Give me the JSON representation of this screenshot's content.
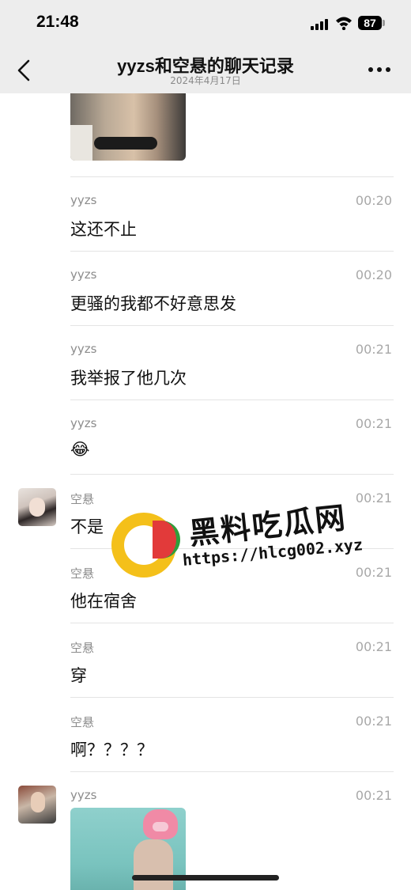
{
  "status_bar": {
    "time": "21:48",
    "battery": "87"
  },
  "nav": {
    "title": "yyzs和空悬的聊天记录",
    "subtitle": "2024年4月17日"
  },
  "messages": [
    {
      "sender": "yyzs",
      "time": "00:20",
      "text": "这还不止"
    },
    {
      "sender": "yyzs",
      "time": "00:20",
      "text": "更骚的我都不好意思发"
    },
    {
      "sender": "yyzs",
      "time": "00:21",
      "text": "我举报了他几次"
    },
    {
      "sender": "yyzs",
      "time": "00:21",
      "text": "😂"
    },
    {
      "sender": "空悬",
      "time": "00:21",
      "text": "不是"
    },
    {
      "sender": "空悬",
      "time": "00:21",
      "text": "他在宿舍"
    },
    {
      "sender": "空悬",
      "time": "00:21",
      "text": "穿"
    },
    {
      "sender": "空悬",
      "time": "00:21",
      "text": "啊？？？？"
    },
    {
      "sender": "yyzs",
      "time": "00:21"
    }
  ],
  "watermark": {
    "brand": "黑料吃瓜网",
    "url": "https://hlcg002.xyz"
  }
}
